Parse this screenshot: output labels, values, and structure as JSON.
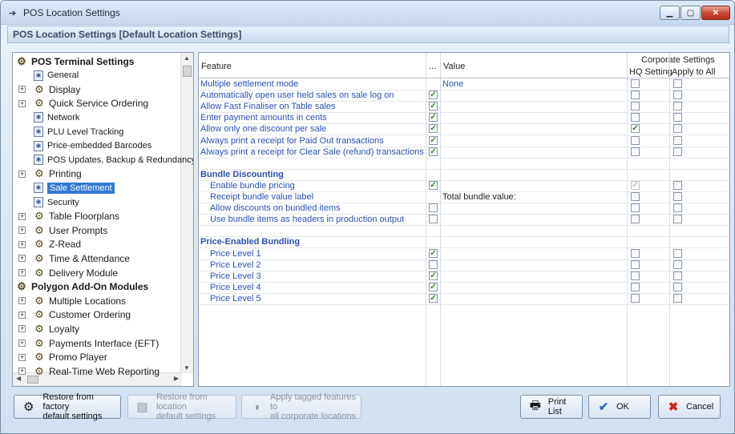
{
  "window": {
    "title": "POS Location Settings"
  },
  "header": {
    "title": "POS Location Settings  [Default Location Settings]"
  },
  "tree": {
    "items": [
      {
        "label": "POS Terminal Settings",
        "level": 0,
        "kind": "root",
        "expander": false
      },
      {
        "label": "General",
        "level": 1,
        "kind": "leaf",
        "expander": false
      },
      {
        "label": "Display",
        "level": 1,
        "kind": "sub",
        "expander": true
      },
      {
        "label": "Quick Service Ordering",
        "level": 1,
        "kind": "sub",
        "expander": true
      },
      {
        "label": "Network",
        "level": 1,
        "kind": "leaf",
        "expander": false
      },
      {
        "label": "PLU Level Tracking",
        "level": 1,
        "kind": "leaf",
        "expander": false
      },
      {
        "label": "Price-embedded Barcodes",
        "level": 1,
        "kind": "leaf",
        "expander": false
      },
      {
        "label": "POS Updates, Backup & Redundancy",
        "level": 1,
        "kind": "leaf",
        "expander": false
      },
      {
        "label": "Printing",
        "level": 1,
        "kind": "sub",
        "expander": true
      },
      {
        "label": "Sale Settlement",
        "level": 1,
        "kind": "leaf",
        "expander": false,
        "selected": true
      },
      {
        "label": "Security",
        "level": 1,
        "kind": "leaf",
        "expander": false
      },
      {
        "label": "Table Floorplans",
        "level": 1,
        "kind": "sub",
        "expander": true
      },
      {
        "label": "User Prompts",
        "level": 1,
        "kind": "sub",
        "expander": true
      },
      {
        "label": "Z-Read",
        "level": 1,
        "kind": "sub",
        "expander": true
      },
      {
        "label": "Time & Attendance",
        "level": 1,
        "kind": "sub",
        "expander": true
      },
      {
        "label": "Delivery Module",
        "level": 1,
        "kind": "sub",
        "expander": true
      },
      {
        "label": "Polygon Add-On Modules",
        "level": 0,
        "kind": "root",
        "expander": false
      },
      {
        "label": "Multiple Locations",
        "level": 1,
        "kind": "sub",
        "expander": true
      },
      {
        "label": "Customer Ordering",
        "level": 1,
        "kind": "sub",
        "expander": true
      },
      {
        "label": "Loyalty",
        "level": 1,
        "kind": "sub",
        "expander": true
      },
      {
        "label": "Payments Interface (EFT)",
        "level": 1,
        "kind": "sub",
        "expander": true
      },
      {
        "label": "Promo Player",
        "level": 1,
        "kind": "sub",
        "expander": true
      },
      {
        "label": "Real-Time Web Reporting",
        "level": 1,
        "kind": "sub",
        "expander": true
      }
    ]
  },
  "grid": {
    "columns": {
      "feature": "Feature",
      "tag": "...",
      "value": "Value",
      "corporate": "Corporate Settings",
      "hq": "HQ Setting",
      "apply": "Apply to All"
    },
    "rows": [
      {
        "type": "feature",
        "label": "Multiple settlement mode",
        "indent": 0,
        "checkbox": false,
        "checked": false,
        "value": "None",
        "valueColor": "#2b4fb8",
        "hq": false,
        "hqDisabled": false,
        "apply": false
      },
      {
        "type": "feature",
        "label": "Automatically open user held sales on sale log on",
        "indent": 0,
        "checkbox": true,
        "checked": true,
        "value": "",
        "hq": false,
        "hqDisabled": false,
        "apply": false
      },
      {
        "type": "feature",
        "label": "Allow Fast Finaliser on Table sales",
        "indent": 0,
        "checkbox": true,
        "checked": true,
        "value": "",
        "hq": false,
        "hqDisabled": false,
        "apply": false
      },
      {
        "type": "feature",
        "label": "Enter payment amounts in cents",
        "indent": 0,
        "checkbox": true,
        "checked": true,
        "value": "",
        "hq": false,
        "hqDisabled": false,
        "apply": false
      },
      {
        "type": "feature",
        "label": "Allow only one discount per sale",
        "indent": 0,
        "checkbox": true,
        "checked": true,
        "value": "",
        "hq": true,
        "hqDisabled": false,
        "apply": false
      },
      {
        "type": "feature",
        "label": "Always print a receipt for Paid Out transactions",
        "indent": 0,
        "checkbox": true,
        "checked": true,
        "value": "",
        "hq": false,
        "hqDisabled": false,
        "apply": false
      },
      {
        "type": "feature",
        "label": "Always print a receipt for Clear Sale (refund) transactions",
        "indent": 0,
        "checkbox": true,
        "checked": true,
        "value": "",
        "hq": false,
        "hqDisabled": false,
        "apply": false
      },
      {
        "type": "blank"
      },
      {
        "type": "heading",
        "label": "Bundle Discounting"
      },
      {
        "type": "feature",
        "label": "Enable bundle pricing",
        "indent": 1,
        "checkbox": true,
        "checked": true,
        "value": "",
        "hq": true,
        "hqDisabled": true,
        "apply": false
      },
      {
        "type": "feature",
        "label": "Receipt bundle value label",
        "indent": 1,
        "checkbox": false,
        "checked": false,
        "value": "Total bundle value:",
        "valueColor": "#222222",
        "hq": false,
        "hqDisabled": false,
        "apply": false
      },
      {
        "type": "feature",
        "label": "Allow discounts on bundled items",
        "indent": 1,
        "checkbox": true,
        "checked": false,
        "value": "",
        "hq": false,
        "hqDisabled": false,
        "apply": false
      },
      {
        "type": "feature",
        "label": "Use bundle items as headers in production output",
        "indent": 1,
        "checkbox": true,
        "checked": false,
        "value": "",
        "hq": false,
        "hqDisabled": false,
        "apply": false
      },
      {
        "type": "blank"
      },
      {
        "type": "heading",
        "label": "Price-Enabled Bundling"
      },
      {
        "type": "feature",
        "label": "Price Level 1",
        "indent": 1,
        "checkbox": true,
        "checked": true,
        "value": "",
        "hq": false,
        "hqDisabled": false,
        "apply": false
      },
      {
        "type": "feature",
        "label": "Price Level 2",
        "indent": 1,
        "checkbox": true,
        "checked": false,
        "value": "",
        "hq": false,
        "hqDisabled": false,
        "apply": false
      },
      {
        "type": "feature",
        "label": "Price Level 3",
        "indent": 1,
        "checkbox": true,
        "checked": true,
        "value": "",
        "hq": false,
        "hqDisabled": false,
        "apply": false
      },
      {
        "type": "feature",
        "label": "Price Level 4",
        "indent": 1,
        "checkbox": true,
        "checked": true,
        "value": "",
        "hq": false,
        "hqDisabled": false,
        "apply": false
      },
      {
        "type": "feature",
        "label": "Price Level 5",
        "indent": 1,
        "checkbox": true,
        "checked": true,
        "value": "",
        "hq": false,
        "hqDisabled": false,
        "apply": false
      }
    ]
  },
  "buttons": {
    "restore_factory": "Restore from factory\ndefault settings",
    "restore_location": "Restore from location\ndefault settings",
    "apply_tagged": "Apply tagged features to\nall corporate locations",
    "print_list": "Print List",
    "ok": "OK",
    "cancel": "Cancel"
  },
  "colors": {
    "selection": "#3178d4",
    "link": "#2b4fb8",
    "check": "#2a8a2a",
    "close": "#c7462f"
  }
}
